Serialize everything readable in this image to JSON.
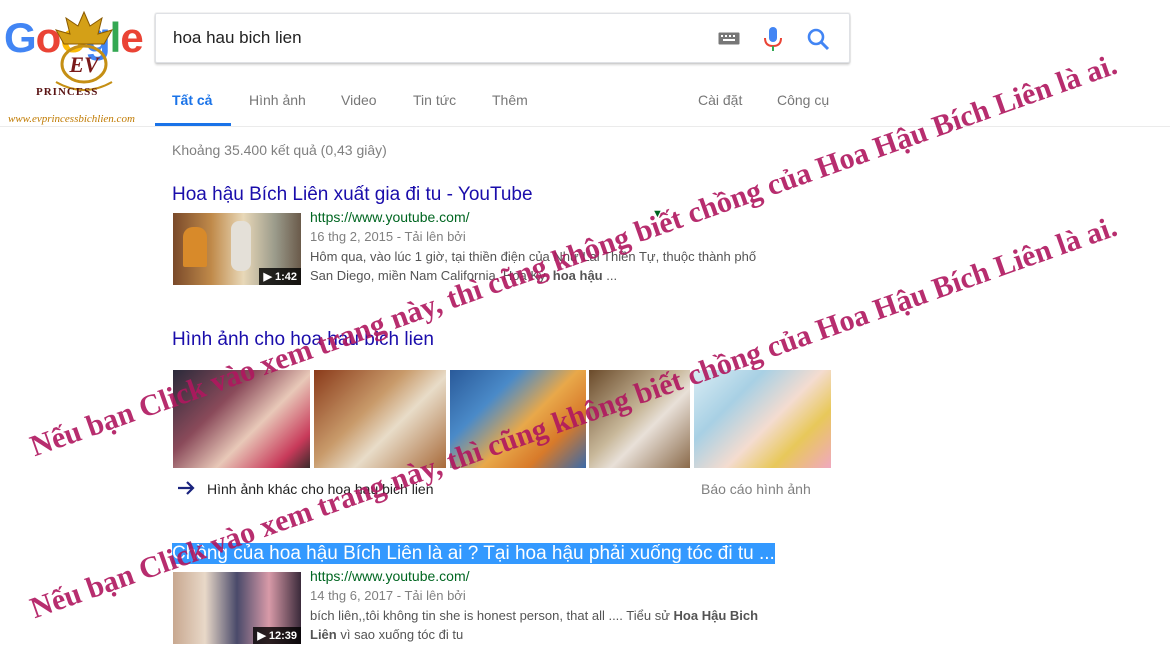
{
  "logo": {
    "letters": [
      "G",
      "o",
      "o",
      "g",
      "l",
      "e"
    ],
    "crest_text": "PRINCESS",
    "site_url": "www.evprincessbichlien.com"
  },
  "search": {
    "query": "hoa hau bich lien"
  },
  "tabs": [
    {
      "label": "Tất cả",
      "active": true
    },
    {
      "label": "Hình ảnh"
    },
    {
      "label": "Video"
    },
    {
      "label": "Tin tức"
    },
    {
      "label": "Thêm"
    }
  ],
  "tools": {
    "settings": "Cài đặt",
    "tools": "Công cụ"
  },
  "stats": "Khoảng 35.400 kết quả (0,43 giây)",
  "results": [
    {
      "title": "Hoa hậu Bích Liên xuất gia đi tu - YouTube",
      "url": "https://www.youtube.com/",
      "meta": "16 thg 2, 2015 - Tải lên bởi",
      "snippet_1": "Hôm qua, vào lúc 1 giờ, tại thiền điện của Như Lai Thiền Tự, thuộc thành phố",
      "snippet_2a": "San Diego, miền Nam California, Hoa Kỳ, ",
      "snippet_2b": "hoa hậu",
      "snippet_2c": " ...",
      "duration": "1:42"
    },
    {
      "title": "Chồng của hoa hậu Bích Liên là ai ? Tại hoa hậu phải xuống tóc đi tu ...",
      "url": "https://www.youtube.com/",
      "meta": "14 thg 6, 2017 - Tải lên bởi",
      "snippet_1a": "bích liên,,tôi không tin she is honest person, that all .... Tiểu sử ",
      "snippet_1b": "Hoa Hậu Bich",
      "snippet_2a": "Liên",
      "snippet_2b": " vì sao xuống tóc đi tu",
      "duration": "12:39"
    }
  ],
  "images_section": {
    "title": "Hình ảnh cho hoa hau bich lien",
    "more": "Hình ảnh khác cho hoa hau bich lien",
    "report": "Báo cáo hình ảnh"
  },
  "watermark": {
    "line_a": "Nếu bạn Click vào xem trang này, thì cũng không biết chồng của Hoa Hậu Bích Liên là ai."
  },
  "colors": {
    "link": "#1a0dab",
    "url": "#006621",
    "accent": "#1a73e8",
    "watermark": "#b0175f",
    "google_blue": "#4285f4",
    "google_red": "#ea4335",
    "google_yellow": "#fbbc05",
    "google_green": "#34a853"
  }
}
